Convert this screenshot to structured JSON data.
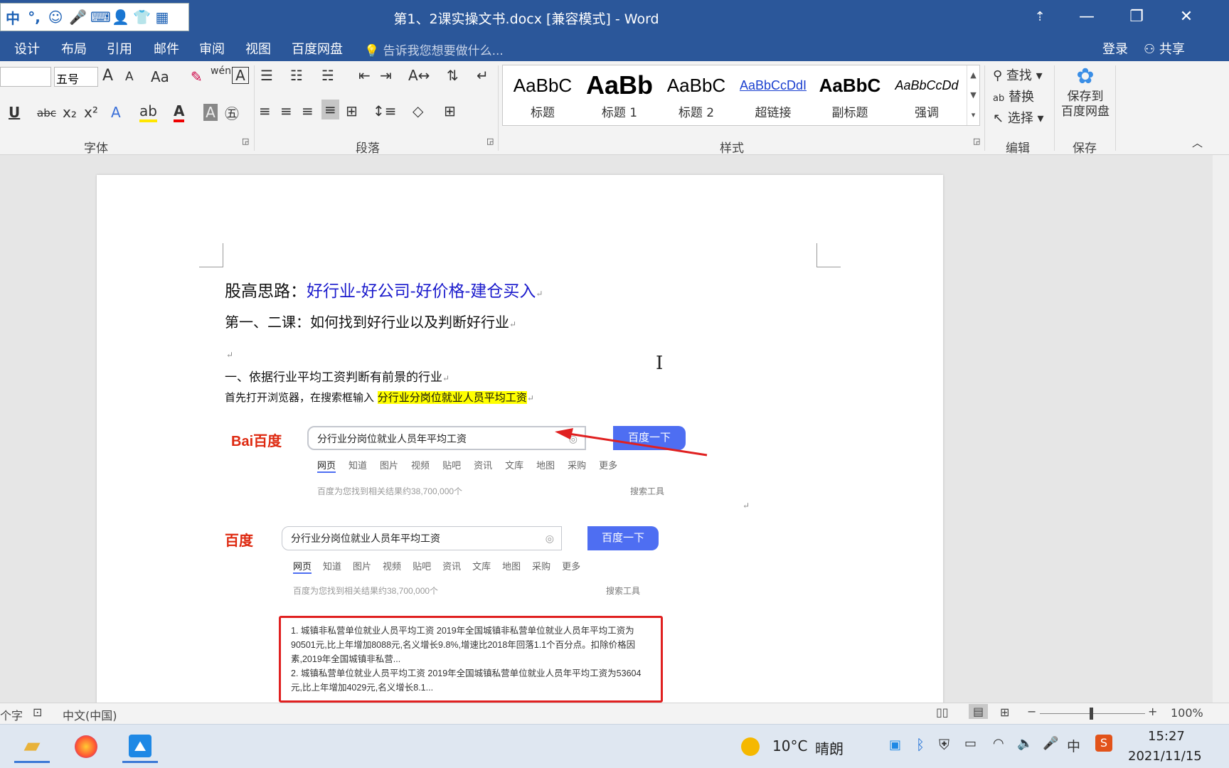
{
  "window": {
    "title": "第1、2课实操文书.docx [兼容模式] - Word",
    "buttons": {
      "restore_ribbon": "⇡",
      "minimize": "—",
      "maximize": "❐",
      "close": "✕"
    }
  },
  "ime_toolbar": [
    "中",
    "°,",
    "☺",
    "🎤",
    "⌨",
    "👤",
    "👕",
    "▦"
  ],
  "tabs": [
    "设计",
    "布局",
    "引用",
    "邮件",
    "审阅",
    "视图",
    "百度网盘"
  ],
  "tell_me": "告诉我您想要做什么...",
  "account": {
    "login": "登录",
    "share": "共享"
  },
  "ribbon": {
    "font": {
      "size": "五号",
      "label": "字体",
      "grow": "A",
      "shrink": "A",
      "case": "Aa"
    },
    "paragraph": {
      "label": "段落"
    },
    "styles": {
      "label": "样式",
      "items": [
        {
          "preview": "AaBbC",
          "name": "标题"
        },
        {
          "preview": "AaBb",
          "name": "标题 1"
        },
        {
          "preview": "AaBbC",
          "name": "标题 2"
        },
        {
          "preview": "AaBbCcDdI",
          "name": "超链接"
        },
        {
          "preview": "AaBbC",
          "name": "副标题"
        },
        {
          "preview": "AaBbCcDd",
          "name": "强调"
        }
      ]
    },
    "edit": {
      "label": "编辑",
      "find": "查找",
      "replace": "替换",
      "select": "选择"
    },
    "save": {
      "label": "保存",
      "button_line1": "保存到",
      "button_line2": "百度网盘"
    }
  },
  "document": {
    "line1_prefix": "股高思路：",
    "line1_blue": "好行业-好公司-好价格-建仓买入",
    "line2": "第一、二课：如何找到好行业以及判断好行业",
    "line3": "一、依据行业平均工资判断有前景的行业",
    "line4_prefix": "首先打开浏览器，在搜索框输入",
    "line4_highlight": "分行业分岗位就业人员平均工资",
    "para_mark": "↵"
  },
  "baidu_shot1": {
    "logo": "Bai百度",
    "query": "分行业分岗位就业人员年平均工资",
    "button": "百度一下",
    "nav": [
      "网页",
      "知道",
      "图片",
      "视频",
      "贴吧",
      "资讯",
      "文库",
      "地图",
      "采购",
      "更多"
    ],
    "count": "百度为您找到相关结果约38,700,000个",
    "tools": "搜索工具"
  },
  "baidu_shot2": {
    "logo": "百度",
    "query": "分行业分岗位就业人员年平均工资",
    "button": "百度一下",
    "nav": [
      "网页",
      "知道",
      "图片",
      "视频",
      "贴吧",
      "资讯",
      "文库",
      "地图",
      "采购",
      "更多"
    ],
    "count": "百度为您找到相关结果约38,700,000个",
    "tools": "搜索工具",
    "results": [
      "1. 城镇非私营单位就业人员平均工资 2019年全国城镇非私营单位就业人员年平均工资为90501元,比上年增加8088元,名义增长9.8%,增速比2018年回落1.1个百分点。扣除价格因素,2019年全国城镇非私营...",
      "2. 城镇私营单位就业人员平均工资 2019年全国城镇私营单位就业人员年平均工资为53604元,比上年增加4029元,名义增长8.1..."
    ]
  },
  "status": {
    "words": "个字",
    "language": "中文(中国)",
    "zoom": "100%"
  },
  "taskbar": {
    "weather_temp": "10°C",
    "weather_text": "晴朗",
    "time": "15:27",
    "date": "2021/11/15",
    "ime": "中"
  },
  "colors": {
    "word_blue": "#2b579a",
    "doc_blue": "#1a1aff",
    "highlight": "#ffff00",
    "baidu_blue": "#4e6ef2",
    "result_border": "#e02020"
  }
}
